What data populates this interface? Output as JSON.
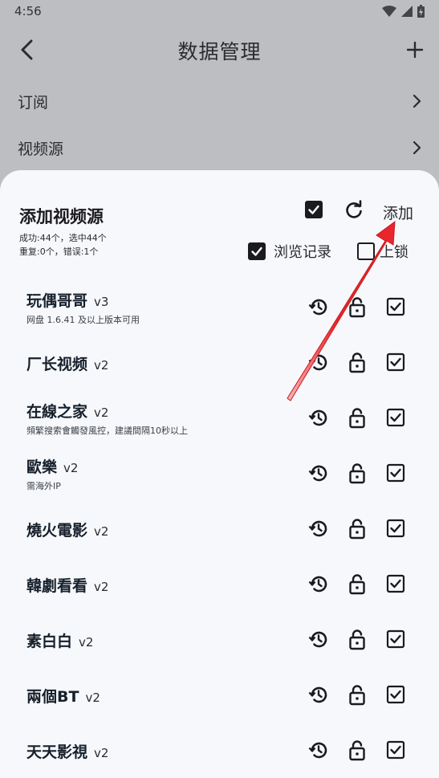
{
  "status": {
    "time": "4:56"
  },
  "appbar": {
    "title": "数据管理"
  },
  "menu": [
    {
      "label": "订阅"
    },
    {
      "label": "视频源"
    }
  ],
  "sheet": {
    "title": "添加视频源",
    "stats_line1": "成功:44个，选中44个",
    "stats_line2": "重复:0个，错误:1个",
    "add_label": "添加",
    "option_history": "浏览记录",
    "option_lock": "上锁"
  },
  "sources": [
    {
      "name": "玩偶哥哥",
      "version": "v3",
      "note": "网盘 1.6.41 及以上版本可用"
    },
    {
      "name": "厂长视频",
      "version": "v2",
      "note": ""
    },
    {
      "name": "在線之家",
      "version": "v2",
      "note": "頻繁搜索會觸發風控，建議間隔10秒以上"
    },
    {
      "name": "歐樂",
      "version": "v2",
      "note": "需海外IP"
    },
    {
      "name": "燒火電影",
      "version": "v2",
      "note": ""
    },
    {
      "name": "韓劇看看",
      "version": "v2",
      "note": ""
    },
    {
      "name": "素白白",
      "version": "v2",
      "note": ""
    },
    {
      "name": "兩個BT",
      "version": "v2",
      "note": ""
    },
    {
      "name": "天天影視",
      "version": "v2",
      "note": ""
    }
  ],
  "colors": {
    "accent_arrow": "#e8262b",
    "sheet_bg": "#f7f8fb",
    "dim_bg": "#bdbec2"
  }
}
